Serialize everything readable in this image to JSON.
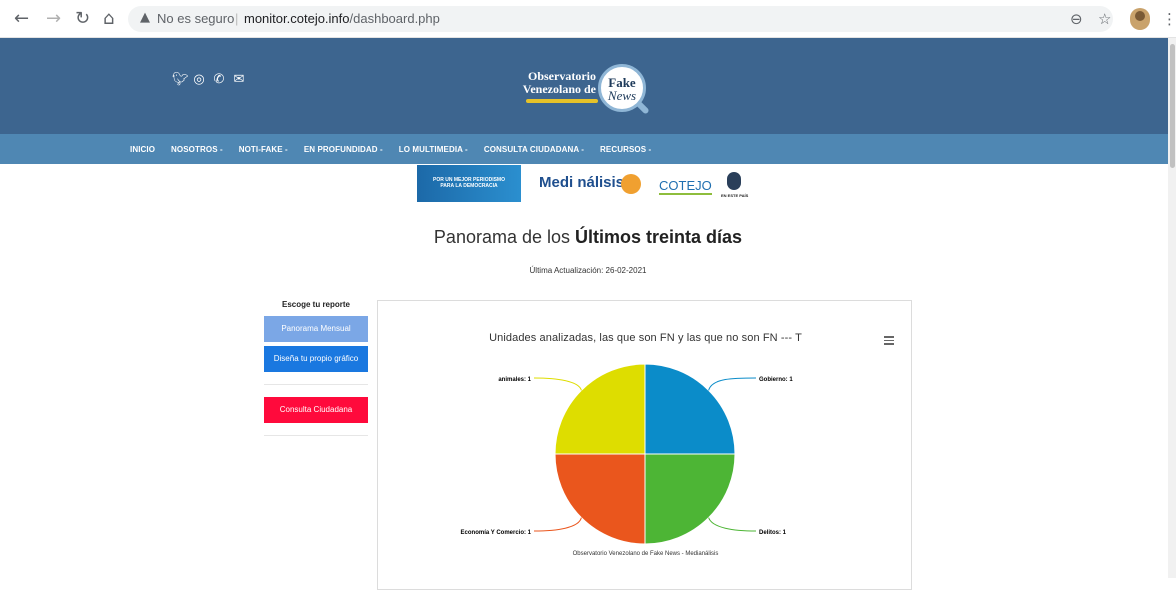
{
  "browser": {
    "security_label": "No es seguro",
    "url_host": "monitor.cotejo.info",
    "url_path": "/dashboard.php",
    "icons": [
      "back-icon",
      "forward-icon",
      "reload-icon",
      "home-icon",
      "warning-icon",
      "zoom-icon",
      "star-icon",
      "profile-avatar",
      "menu-icon"
    ]
  },
  "header": {
    "social_icons": [
      "twitter-icon",
      "instagram-icon",
      "whatsapp-icon",
      "mail-icon"
    ],
    "logo": {
      "line1": "Observatorio",
      "line2": "Venezolano de",
      "fake": "Fake",
      "news": "News"
    }
  },
  "nav": {
    "items": [
      "INICIO",
      "NOSOTROS -",
      "NOTI-FAKE -",
      "EN PROFUNDIDAD -",
      "LO MULTIMEDIA -",
      "CONSULTA CIUDADANA -",
      "RECURSOS -"
    ]
  },
  "sponsors": {
    "tagline1": "POR UN MEJOR PERIODISMO",
    "tagline2": "PARA LA DEMOCRACIA",
    "medianalisis": "Medi  nálisis",
    "cotejo": "COTEJO",
    "en_este_pais": "EN ESTE PAÍS"
  },
  "page": {
    "title_prefix": "Panorama de los ",
    "title_bold": "Últimos treinta días",
    "update": "Última Actualización: 26-02-2021"
  },
  "sidebar": {
    "heading": "Escoge tu reporte",
    "btn_monthly": "Panorama Mensual",
    "btn_custom": "Diseña tu propio gráfico",
    "btn_citizen": "Consulta Ciudadana"
  },
  "chart_data": {
    "type": "pie",
    "title": "Unidades analizadas, las que son FN y las que no son FN --- T",
    "credit": "Observatorio Venezolano de Fake News - Medianálisis",
    "slices": [
      {
        "label": "Gobierno: 1",
        "name": "Gobierno",
        "value": 1,
        "color": "#0b8cc9"
      },
      {
        "label": "Delitos: 1",
        "name": "Delitos",
        "value": 1,
        "color": "#4db535"
      },
      {
        "label": "Economía Y Comercio: 1",
        "name": "Economía Y Comercio",
        "value": 1,
        "color": "#ea561d"
      },
      {
        "label": "animales: 1",
        "name": "animales",
        "value": 1,
        "color": "#dedd00"
      }
    ]
  }
}
